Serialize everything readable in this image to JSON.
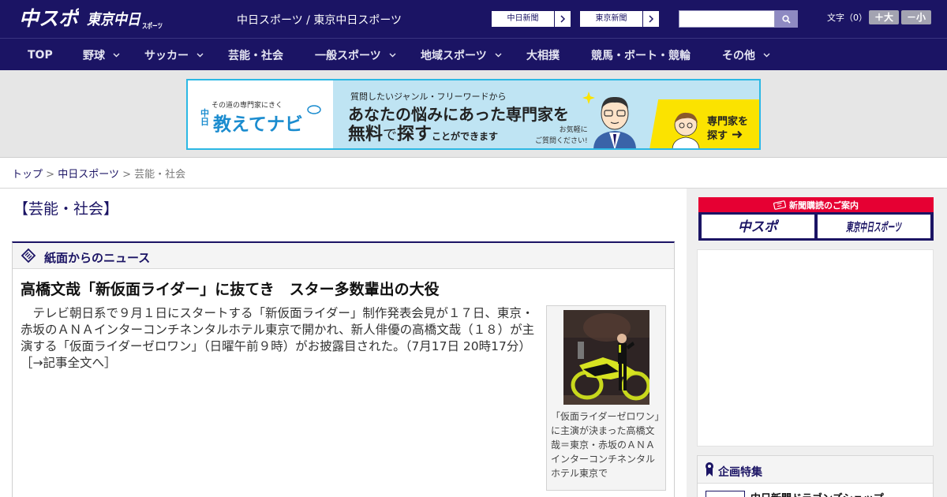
{
  "header": {
    "logo_primary": "中スポ",
    "logo_secondary": "東京中日スポーツ",
    "site_title": "中日スポーツ / 東京中日スポーツ",
    "paper_links": [
      {
        "label": "中日新聞"
      },
      {
        "label": "東京新聞"
      }
    ],
    "search": {
      "placeholder": "",
      "value": ""
    },
    "font_size": {
      "label": "文字（0）",
      "increase": "＋大",
      "decrease": "－小"
    }
  },
  "nav": {
    "items": [
      {
        "label": "TOP",
        "has_menu": false
      },
      {
        "label": "野球",
        "has_menu": true
      },
      {
        "label": "サッカー",
        "has_menu": true
      },
      {
        "label": "芸能・社会",
        "has_menu": false
      },
      {
        "label": "一般スポーツ",
        "has_menu": true
      },
      {
        "label": "地域スポーツ",
        "has_menu": true
      },
      {
        "label": "大相撲",
        "has_menu": false
      },
      {
        "label": "競馬・ボート・競輪",
        "has_menu": false
      },
      {
        "label": "その他",
        "has_menu": true
      }
    ]
  },
  "ad_banner": {
    "small_text": "その道の専門家にきく",
    "brand_small": "中日",
    "brand": "教えてナビ",
    "line1": "質問したいジャンル・フリーワードから",
    "line2": "あなたの悩みにあった専門家を",
    "line3_a": "無料",
    "line3_b": "で",
    "line3_c": "探す",
    "line3_d": "ことができます",
    "bubble_1": "お気軽に",
    "bubble_2": "ご質問ください!",
    "cta_1": "専門家を",
    "cta_2": "探す"
  },
  "breadcrumb": {
    "items": [
      "トップ",
      "中日スポーツ",
      "芸能・社会"
    ],
    "separator": ">"
  },
  "main": {
    "section_heading": "【芸能・社会】",
    "news_box_title": "紙面からのニュース",
    "article": {
      "title": "高橋文哉「新仮面ライダー」に抜てき　スター多数輩出の大役",
      "body": "　テレビ朝日系で９月１日にスタートする「新仮面ライダー」制作発表会見が１７日、東京・赤坂のＡＮＡインターコンチネンタルホテル東京で開かれ、新人俳優の高橋文哉（１８）が主演する「仮面ライダーゼロワン」（日曜午前９時）がお披露目された。（7月17日 20時17分）",
      "read_more": "［→記事全文へ］",
      "photo_caption": "「仮面ライダーゼロワン」に主演が決まった高橋文哉＝東京・赤坂のＡＮＡインターコンチネンタルホテル東京で"
    }
  },
  "sidebar": {
    "subscription_title": "新聞購読のご案内",
    "subscription_buttons": [
      "中スポ",
      "東京中日スポーツ"
    ],
    "feature_title": "企画特集",
    "feature_items": [
      "中日新聞ドラゴンズショップ"
    ]
  },
  "colors": {
    "brand_navy": "#1b1464",
    "subscription_red": "#e60033",
    "ad_border": "#2cb8e4",
    "ad_yellow": "#fbe300"
  }
}
